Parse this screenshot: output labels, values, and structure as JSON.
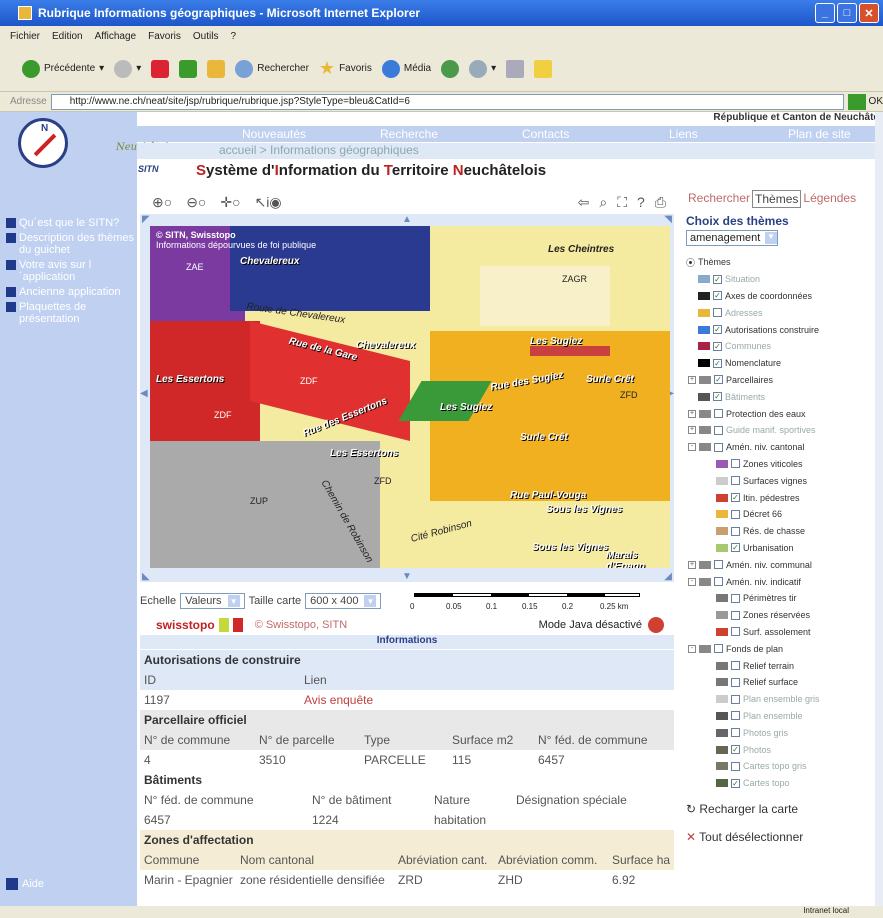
{
  "window": {
    "title": "Rubrique Informations géographiques - Microsoft Internet Explorer"
  },
  "menu": [
    "Fichier",
    "Edition",
    "Affichage",
    "Favoris",
    "Outils",
    "?"
  ],
  "toolbar": {
    "back": "Précédente",
    "search": "Rechercher",
    "favorites": "Favoris",
    "media": "Média"
  },
  "address": {
    "label": "Adresse",
    "url": "http://www.ne.ch/neat/site/jsp/rubrique/rubrique.jsp?StyleType=bleu&CatId=6",
    "go": "OK"
  },
  "header": {
    "republique": "République et Canton de Neuchâte",
    "signature": "Neuchâtel:"
  },
  "nav": {
    "items": [
      "Nouveautés",
      "Recherche",
      "Contacts",
      "Liens",
      "Plan de site"
    ]
  },
  "breadcrumb": "accueil > Informations géographiques",
  "sitn": {
    "logo": "SITN",
    "title_parts": [
      [
        "S",
        "ystème d'"
      ],
      [
        "I",
        "nformation du "
      ],
      [
        "T",
        "erritoire "
      ],
      [
        "N",
        "euchâtelois"
      ]
    ]
  },
  "leftnav": [
    "Qu´est que le SITN?",
    "Description des thèmes du guichet",
    "Votre avis sur l´application",
    "Ancienne application",
    "Plaquettes de présentation"
  ],
  "aide": "Aide",
  "map": {
    "copyright": "© SITN, Swisstopo",
    "disclaimer": "Informations dépourvues de foi publique",
    "labels": [
      "Chevalereux",
      "Les Cheintres",
      "ZAGR",
      "Route de Chevalereux",
      "Rue de la Gare",
      "Chevalereux",
      "Les Sugiez",
      "Les Essertons",
      "Les Sugiez",
      "Surle Crêt",
      "Rue des Sugiez",
      "Rue des Essertons",
      "Les Essertons",
      "Surle Crêt",
      "Rue Paul-Vouga",
      "Sous les Vignes",
      "Cité Robinson",
      "Chemin de Robinson",
      "Sous les Vignes",
      "Marais d'Epagn"
    ],
    "codes": [
      "ZAE",
      "ZDF",
      "ZDF",
      "ZUP",
      "ZFD",
      "ZFD"
    ]
  },
  "echelle": {
    "label": "Echelle",
    "value": "Valeurs",
    "taille_label": "Taille carte",
    "taille": "600 x 400"
  },
  "scale": {
    "ticks": [
      "0",
      "0.05",
      "0.1",
      "0.15",
      "0.2",
      "0.25 km"
    ]
  },
  "credit": {
    "brand": "swisstopo",
    "copyright": "© Swisstopo, SITN",
    "java": "Mode Java désactivé"
  },
  "info": {
    "header": "Informations",
    "autorisations": {
      "title": "Autorisations de construire",
      "cols": [
        "ID",
        "Lien"
      ],
      "row": [
        "1197",
        "Avis enquête"
      ]
    },
    "parcellaire": {
      "title": "Parcellaire officiel",
      "cols": [
        "N° de commune",
        "N° de parcelle",
        "Type",
        "Surface m2",
        "N° féd. de commune"
      ],
      "row": [
        "4",
        "3510",
        "PARCELLE",
        "115",
        "6457"
      ]
    },
    "batiments": {
      "title": "Bâtiments",
      "cols": [
        "N° féd. de commune",
        "N° de bâtiment",
        "Nature",
        "Désignation spéciale"
      ],
      "row": [
        "6457",
        "1224",
        "habitation",
        ""
      ]
    },
    "zones": {
      "title": "Zones d'affectation",
      "cols": [
        "Commune",
        "Nom cantonal",
        "Abréviation cant.",
        "Abréviation comm.",
        "Surface ha"
      ],
      "row": [
        "Marin - Epagnier",
        "zone résidentielle densifiée",
        "ZRD",
        "ZHD",
        "6.92"
      ]
    }
  },
  "right": {
    "tabs": [
      "Rechercher",
      "Thèmes",
      "Légendes"
    ],
    "choix": "Choix des thèmes",
    "theme_select": "amenagement",
    "root": "Thèmes",
    "tree": [
      {
        "label": "Situation",
        "checked": true,
        "fade": true,
        "indent": 1
      },
      {
        "label": "Axes de coordonnées",
        "checked": true,
        "fade": false,
        "indent": 1
      },
      {
        "label": "Adresses",
        "checked": false,
        "fade": true,
        "indent": 1
      },
      {
        "label": "Autorisations construire",
        "checked": true,
        "fade": false,
        "indent": 1
      },
      {
        "label": "Communes",
        "checked": true,
        "fade": true,
        "indent": 1
      },
      {
        "label": "Nomenclature",
        "checked": true,
        "fade": false,
        "indent": 1
      },
      {
        "label": "Parcellaires",
        "checked": true,
        "fade": false,
        "indent": 0,
        "pm": "+"
      },
      {
        "label": "Bâtiments",
        "checked": true,
        "fade": true,
        "indent": 1
      },
      {
        "label": "Protection des eaux",
        "checked": false,
        "fade": false,
        "indent": 0,
        "pm": "+"
      },
      {
        "label": "Guide manif. sportives",
        "checked": false,
        "fade": true,
        "indent": 0,
        "pm": "+"
      },
      {
        "label": "Amén. niv. cantonal",
        "checked": false,
        "fade": false,
        "indent": 0,
        "pm": "-"
      },
      {
        "label": "Zones viticoles",
        "checked": false,
        "fade": false,
        "indent": 2
      },
      {
        "label": "Surfaces vignes",
        "checked": false,
        "fade": false,
        "indent": 2
      },
      {
        "label": "Itin. pédestres",
        "checked": true,
        "fade": false,
        "indent": 2
      },
      {
        "label": "Décret 66",
        "checked": false,
        "fade": false,
        "indent": 2
      },
      {
        "label": "Rés. de chasse",
        "checked": false,
        "fade": false,
        "indent": 2
      },
      {
        "label": "Urbanisation",
        "checked": true,
        "fade": false,
        "indent": 2
      },
      {
        "label": "Amén. niv. communal",
        "checked": false,
        "fade": false,
        "indent": 0,
        "pm": "+"
      },
      {
        "label": "Amén. niv. indicatif",
        "checked": false,
        "fade": false,
        "indent": 0,
        "pm": "-"
      },
      {
        "label": "Périmètres tir",
        "checked": false,
        "fade": false,
        "indent": 2
      },
      {
        "label": "Zones réservées",
        "checked": false,
        "fade": false,
        "indent": 2
      },
      {
        "label": "Surf. assolement",
        "checked": false,
        "fade": false,
        "indent": 2
      },
      {
        "label": "Fonds de plan",
        "checked": false,
        "fade": false,
        "indent": 0,
        "pm": "-"
      },
      {
        "label": "Relief terrain",
        "checked": false,
        "fade": false,
        "indent": 2
      },
      {
        "label": "Relief surface",
        "checked": false,
        "fade": false,
        "indent": 2
      },
      {
        "label": "Plan ensemble gris",
        "checked": false,
        "fade": true,
        "indent": 2
      },
      {
        "label": "Plan ensemble",
        "checked": false,
        "fade": true,
        "indent": 2
      },
      {
        "label": "Photos gris",
        "checked": false,
        "fade": true,
        "indent": 2
      },
      {
        "label": "Photos",
        "checked": true,
        "fade": true,
        "indent": 2
      },
      {
        "label": "Cartes topo gris",
        "checked": false,
        "fade": true,
        "indent": 2
      },
      {
        "label": "Cartes topo",
        "checked": true,
        "fade": true,
        "indent": 2
      }
    ],
    "reload": "Recharger la carte",
    "deselect": "Tout désélectionner"
  },
  "status": {
    "zone": "Intranet local"
  }
}
